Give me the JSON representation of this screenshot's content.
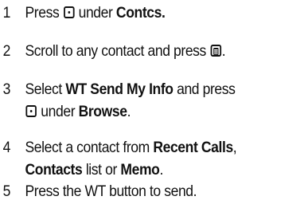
{
  "steps": [
    {
      "number": "1",
      "t1": "Press",
      "icon": "center-select-key-icon",
      "t2": "under",
      "t3": "Contcs."
    },
    {
      "number": "2",
      "t1": "Scroll to any contact and press",
      "icon": "menu-key-icon",
      "t2": "."
    },
    {
      "number": "3",
      "t1": "Select",
      "b1": "WT Send My Info",
      "t2": "and press",
      "icon": "center-select-key-icon",
      "t3": "under",
      "b2": "Browse",
      "t4": "."
    },
    {
      "number": "4",
      "t1": "Select a contact from",
      "b1": "Recent Calls",
      "t2": ",",
      "b2": "Contacts",
      "t3": "list or",
      "b3": "Memo",
      "t4": "."
    },
    {
      "number": "5",
      "t1": "Press the WT button to send."
    }
  ]
}
